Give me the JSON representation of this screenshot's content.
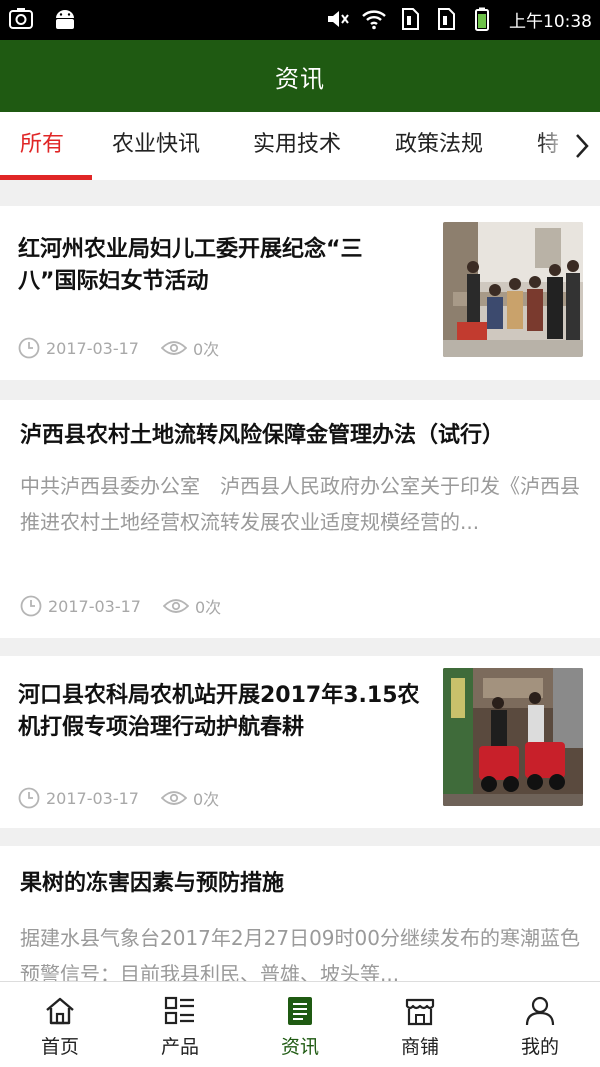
{
  "status_bar": {
    "time": "上午10:38"
  },
  "header": {
    "title": "资讯"
  },
  "tabs": [
    {
      "label": "所有"
    },
    {
      "label": "农业快讯"
    },
    {
      "label": "实用技术"
    },
    {
      "label": "政策法规"
    },
    {
      "label": "特"
    }
  ],
  "articles": [
    {
      "title": "红河州农业局妇儿工委开展纪念“三八”国际妇女节活动",
      "summary": "",
      "date": "2017-03-17",
      "views": "0次"
    },
    {
      "title": "泸西县农村土地流转风险保障金管理办法（试行）",
      "summary": "中共泸西县委办公室　泸西县人民政府办公室关于印发《泸西县推进农村土地经营权流转发展农业适度规模经营的...",
      "date": "2017-03-17",
      "views": "0次"
    },
    {
      "title": "河口县农科局农机站开展2017年3.15农机打假专项治理行动护航春耕",
      "summary": "",
      "date": "2017-03-17",
      "views": "0次"
    },
    {
      "title": "果树的冻害因素与预防措施",
      "summary": "据建水县气象台2017年2月27日09时00分继续发布的寒潮蓝色预警信号：目前我县利民、普雄、坡头等...",
      "date": "",
      "views": ""
    }
  ],
  "bottom_nav": [
    {
      "label": "首页"
    },
    {
      "label": "产品"
    },
    {
      "label": "资讯"
    },
    {
      "label": "商铺"
    },
    {
      "label": "我的"
    }
  ],
  "colors": {
    "brand_green": "#1f5a12",
    "tab_active": "#e02626",
    "meta_gray": "#a8a8a8"
  }
}
